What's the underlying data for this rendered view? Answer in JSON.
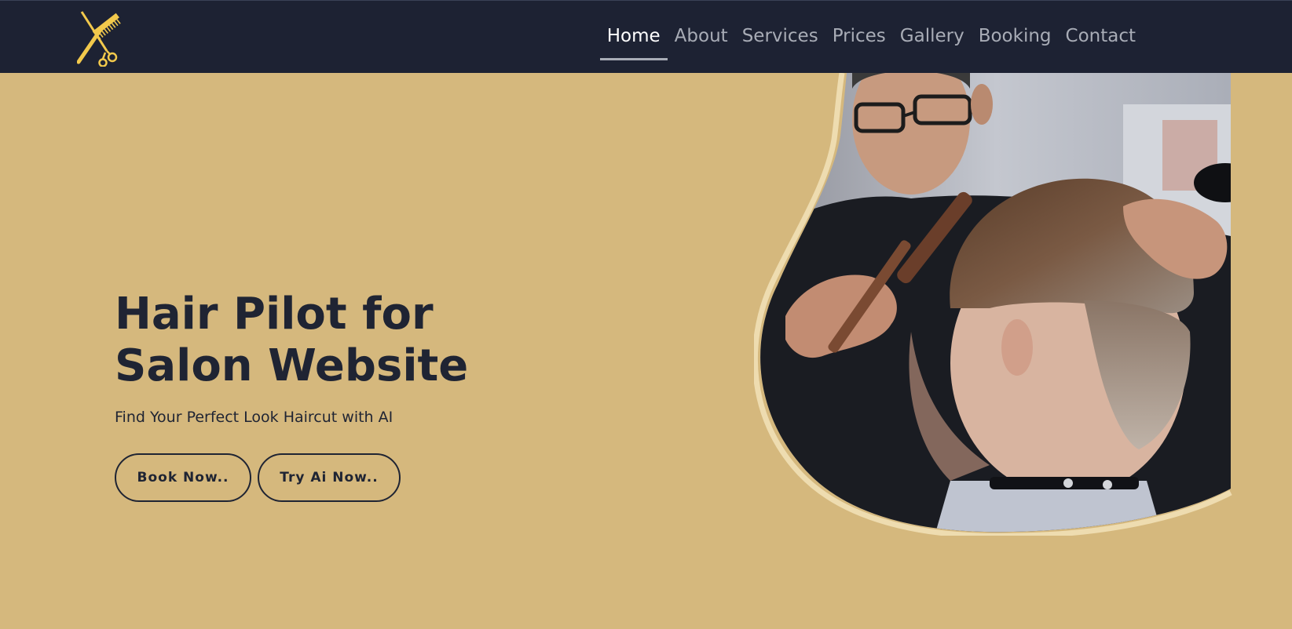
{
  "nav": {
    "logo_icon": "scissors-comb-logo-icon",
    "items": [
      {
        "label": "Home",
        "active": true
      },
      {
        "label": "About",
        "active": false
      },
      {
        "label": "Services",
        "active": false
      },
      {
        "label": "Prices",
        "active": false
      },
      {
        "label": "Gallery",
        "active": false
      },
      {
        "label": "Booking",
        "active": false
      },
      {
        "label": "Contact",
        "active": false
      }
    ]
  },
  "hero": {
    "title": "Hair Pilot for Salon Website",
    "subtitle": "Find Your Perfect Look Haircut with AI",
    "book_button": "Book Now..",
    "ai_button": "Try Ai Now..",
    "photo_subject": "barber-styling-customer-haircut"
  },
  "colors": {
    "navbar": "#1d2233",
    "background": "#d5b87d",
    "text_dark": "#1f2433",
    "logo": "#f2c94c",
    "nav_inactive": "#a8acb6",
    "nav_active": "#ffffff"
  }
}
